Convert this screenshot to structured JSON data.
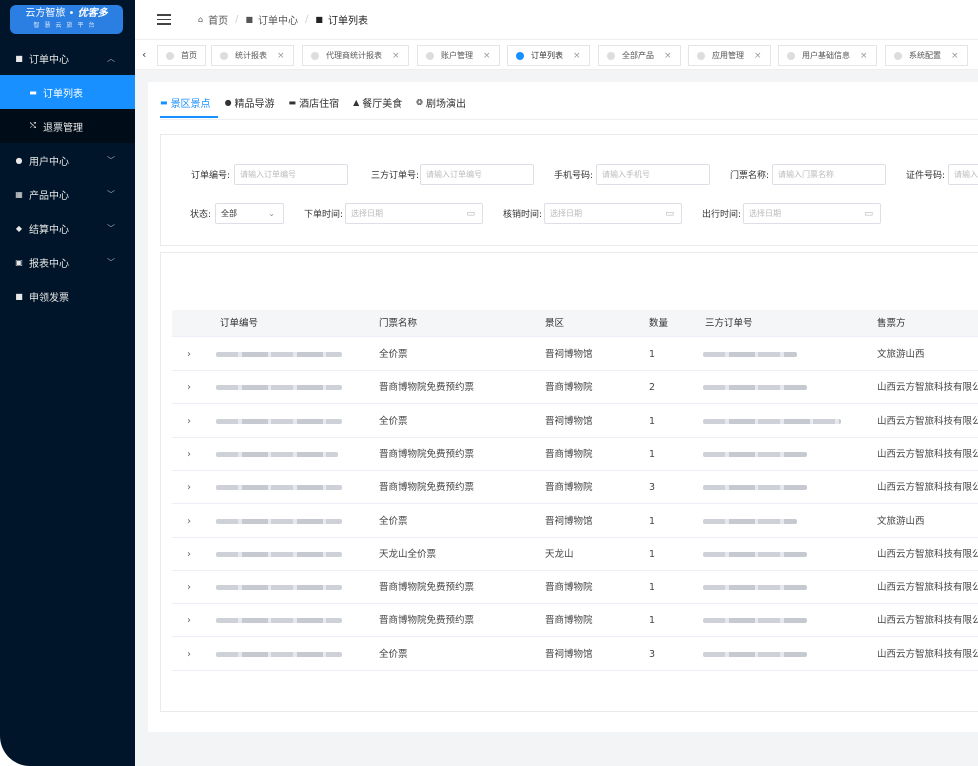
{
  "logo": {
    "line1_a": "云方智旅 • ",
    "line1_b": "优客多",
    "line2": "智慧云旅平台"
  },
  "sidebar": {
    "items": [
      {
        "label": "订单中心",
        "icon": "order-icon",
        "expanded": true,
        "children": [
          {
            "label": "订单列表",
            "icon": "list-icon",
            "active": true
          },
          {
            "label": "退票管理",
            "icon": "refund-icon"
          }
        ]
      },
      {
        "label": "用户中心",
        "icon": "user-icon"
      },
      {
        "label": "产品中心",
        "icon": "grid-icon"
      },
      {
        "label": "结算中心",
        "icon": "settle-icon"
      },
      {
        "label": "报表中心",
        "icon": "report-icon"
      },
      {
        "label": "申领发票",
        "icon": "invoice-icon"
      }
    ]
  },
  "header": {
    "breadcrumb": [
      {
        "label": "首页",
        "icon": "home-icon"
      },
      {
        "label": "订单中心",
        "icon": "folder-icon"
      },
      {
        "label": "订单列表",
        "icon": "folder-icon"
      }
    ]
  },
  "tabs": [
    {
      "label": "首页",
      "closable": false
    },
    {
      "label": "统计报表",
      "closable": true
    },
    {
      "label": "代理商统计报表",
      "closable": true
    },
    {
      "label": "账户管理",
      "closable": true
    },
    {
      "label": "订单列表",
      "closable": true,
      "active": true
    },
    {
      "label": "全部产品",
      "closable": true
    },
    {
      "label": "应用管理",
      "closable": true
    },
    {
      "label": "用户基础信息",
      "closable": true
    },
    {
      "label": "系统配置",
      "closable": true
    }
  ],
  "categories": [
    {
      "label": "景区景点",
      "icon": "ticket-icon",
      "active": true
    },
    {
      "label": "精品导游",
      "icon": "guide-icon"
    },
    {
      "label": "酒店住宿",
      "icon": "bed-icon"
    },
    {
      "label": "餐厅美食",
      "icon": "food-icon"
    },
    {
      "label": "剧场演出",
      "icon": "theater-icon"
    }
  ],
  "filters": {
    "order_no": {
      "label": "订单编号:",
      "placeholder": "请输入订单编号"
    },
    "third_no": {
      "label": "三方订单号:",
      "placeholder": "请输入订单编号"
    },
    "phone": {
      "label": "手机号码:",
      "placeholder": "请输入手机号"
    },
    "ticket_name": {
      "label": "门票名称:",
      "placeholder": "请输入门票名称"
    },
    "id_no": {
      "label": "证件号码:",
      "placeholder": "请输入"
    },
    "status": {
      "label": "状态:",
      "value": "全部"
    },
    "order_time": {
      "label": "下单时间:",
      "placeholder": "选择日期"
    },
    "verify_time": {
      "label": "核销时间:",
      "placeholder": "选择日期"
    },
    "travel_time": {
      "label": "出行时间:",
      "placeholder": "选择日期"
    }
  },
  "table": {
    "columns": [
      "订单编号",
      "门票名称",
      "景区",
      "数量",
      "三方订单号",
      "售票方"
    ],
    "rows": [
      {
        "ticket": "全价票",
        "scenic": "晋祠博物馆",
        "qty": "1",
        "seller": "文旅游山西"
      },
      {
        "ticket": "晋商博物院免费预约票",
        "scenic": "晋商博物院",
        "qty": "2",
        "seller": "山西云方智旅科技有限公"
      },
      {
        "ticket": "全价票",
        "scenic": "晋祠博物馆",
        "qty": "1",
        "seller": "山西云方智旅科技有限公"
      },
      {
        "ticket": "晋商博物院免费预约票",
        "scenic": "晋商博物院",
        "qty": "1",
        "seller": "山西云方智旅科技有限公"
      },
      {
        "ticket": "晋商博物院免费预约票",
        "scenic": "晋商博物院",
        "qty": "3",
        "seller": "山西云方智旅科技有限公"
      },
      {
        "ticket": "全价票",
        "scenic": "晋祠博物馆",
        "qty": "1",
        "seller": "文旅游山西"
      },
      {
        "ticket": "天龙山全价票",
        "scenic": "天龙山",
        "qty": "1",
        "seller": "山西云方智旅科技有限公"
      },
      {
        "ticket": "晋商博物院免费预约票",
        "scenic": "晋商博物院",
        "qty": "1",
        "seller": "山西云方智旅科技有限公"
      },
      {
        "ticket": "晋商博物院免费预约票",
        "scenic": "晋商博物院",
        "qty": "1",
        "seller": "山西云方智旅科技有限公"
      },
      {
        "ticket": "全价票",
        "scenic": "晋祠博物馆",
        "qty": "3",
        "seller": "山西云方智旅科技有限公"
      }
    ]
  }
}
